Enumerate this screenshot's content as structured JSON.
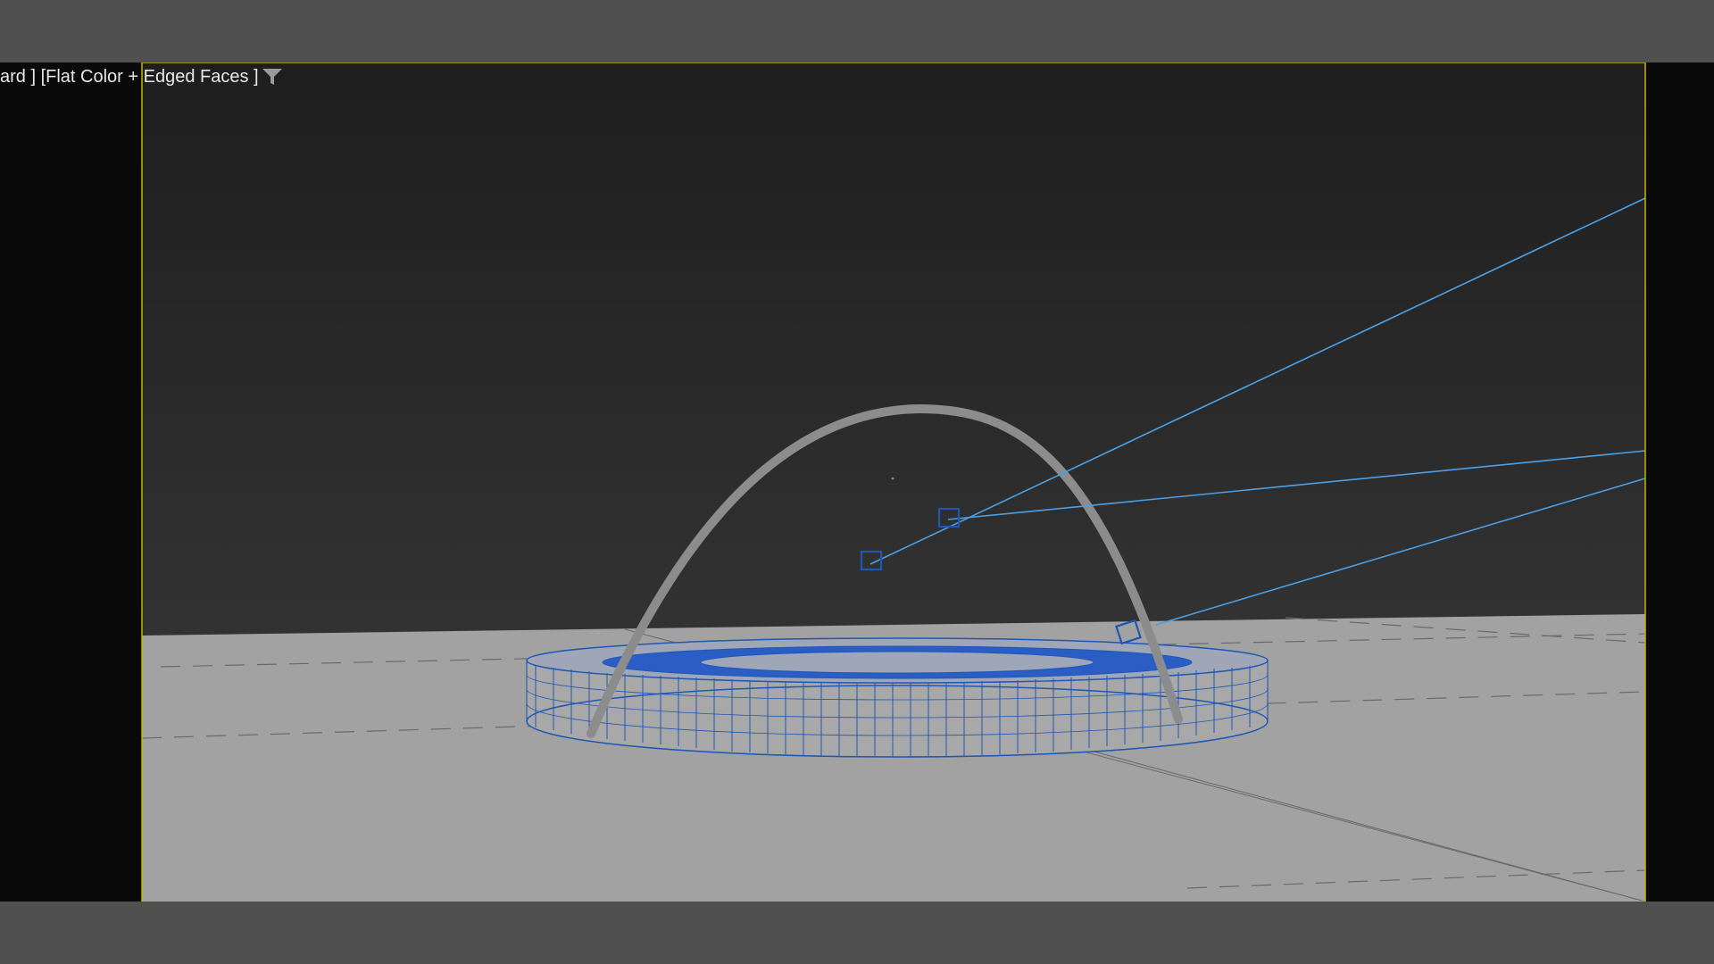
{
  "viewport": {
    "label_shading_mode": "ard ] [Flat Color + Edged Faces ]",
    "filter_icon": "funnel-icon",
    "colors": {
      "sky_top": "#1e1e1e",
      "sky_bottom": "#3c3c3c",
      "ground": "#a2a2a2",
      "frame_border": "#c8b400",
      "wireframe": "#1f57b5",
      "arc_particles": "#8c8c8c",
      "light_rays": "#4aa0e6"
    }
  }
}
